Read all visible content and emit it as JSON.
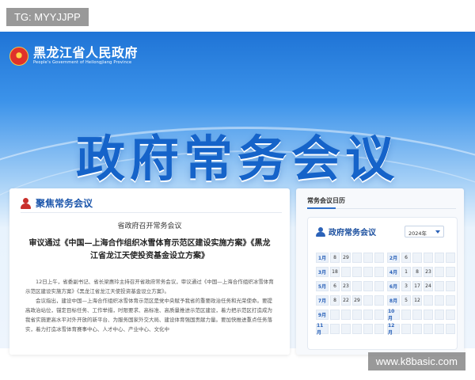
{
  "watermark": {
    "top_left": "TG: MYYJJPP",
    "bottom_right": "www.k8basic.com"
  },
  "header": {
    "logo_cn": "黑龙江省人民政府",
    "logo_en": "People's Government of Heilongjiang Province",
    "banner_title": "政府常务会议"
  },
  "focus": {
    "section_title": "聚焦常务会议",
    "notice": "省政府召开常务会议",
    "article_title": "审议通过《中国—上海合作组织冰雪体育示范区建设实施方案》《黑龙江省龙江天使投资基金设立方案》",
    "paragraphs": [
      "12日上午，省委副书记、省长梁惠玲主持召开省政府常务会议，审议通过《中国—上海合作组织冰雪体育示范区建设实施方案》《黑龙江省龙江天使投资基金设立方案》。",
      "会议指出，建设中国—上海合作组织冰雪体育示范区是党中央赋予我省的重要政治任务和光荣使命。要提高政治站位，锚定目标任务、工作举措，时限要求、高标准、高质量推进示范区建设，着力把示范区打造成为我省实施更高水平对外开放的新平台、为服务国家外交大局、建设体育强国贡献力量。要加快推进重点任务落实，着力打造冰雪体育赛事中心、人才中心、产业中心、文化中"
    ]
  },
  "calendar": {
    "section_title": "常务会议日历",
    "box_title": "政府常务会议",
    "year_value": "2024年",
    "rows": [
      {
        "left": {
          "month": "1月",
          "days": [
            "8",
            "29",
            "",
            "",
            ""
          ]
        },
        "right": {
          "month": "2月",
          "days": [
            "6",
            "",
            "",
            "",
            ""
          ]
        }
      },
      {
        "left": {
          "month": "3月",
          "days": [
            "18",
            "",
            "",
            "",
            ""
          ]
        },
        "right": {
          "month": "4月",
          "days": [
            "1",
            "8",
            "23",
            "",
            ""
          ]
        }
      },
      {
        "left": {
          "month": "5月",
          "days": [
            "6",
            "23",
            "",
            "",
            ""
          ]
        },
        "right": {
          "month": "6月",
          "days": [
            "3",
            "17",
            "24",
            "",
            ""
          ]
        }
      },
      {
        "left": {
          "month": "7月",
          "days": [
            "8",
            "22",
            "29",
            "",
            ""
          ]
        },
        "right": {
          "month": "8月",
          "days": [
            "5",
            "12",
            "",
            "",
            ""
          ]
        }
      },
      {
        "left": {
          "month": "9月",
          "days": [
            "",
            "",
            "",
            "",
            ""
          ]
        },
        "right": {
          "month": "10月",
          "days": [
            "",
            "",
            "",
            "",
            ""
          ]
        }
      },
      {
        "left": {
          "month": "11月",
          "days": [
            "",
            "",
            "",
            "",
            ""
          ]
        },
        "right": {
          "month": "12月",
          "days": [
            "",
            "",
            "",
            "",
            ""
          ]
        }
      }
    ]
  },
  "colors": {
    "brand_blue": "#1563c9",
    "accent_red": "#c9302c"
  }
}
